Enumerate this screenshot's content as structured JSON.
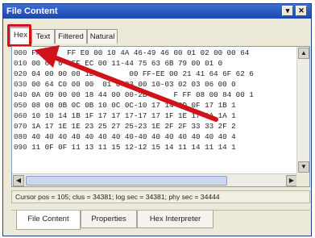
{
  "window": {
    "title": "File Content",
    "pin_glyph": "▾",
    "close_glyph": "✕"
  },
  "tabs": [
    {
      "label": "Hex",
      "active": true
    },
    {
      "label": "Text",
      "active": false
    },
    {
      "label": "Filtered",
      "active": false
    },
    {
      "label": "Natural",
      "active": false
    }
  ],
  "hex_rows": [
    {
      "offset": "000",
      "bytes": "FF  F   FF E0 00 10 4A 46-49 46 00 01 02 00 00 64"
    },
    {
      "offset": "010",
      "bytes": "00 64 0  FF EC 00 11-44 75 63 6B 79 00 01 0"
    },
    {
      "offset": "020",
      "bytes": "04 00 00 00 1E        00 FF-EE 00 21 41 64 6F 62 6"
    },
    {
      "offset": "030",
      "bytes": "00 64 C0 00 00  01 0 03 00 10-03 02 03 06 00 0"
    },
    {
      "offset": "040",
      "bytes": "0A 09 00 00 18 44 00 00-2B      F FF 08 00 84 00 1"
    },
    {
      "offset": "050",
      "bytes": "08 08 0B 0C 0B 10 0C 0C-10 17 14 0D 0F 17 1B 1"
    },
    {
      "offset": "060",
      "bytes": "10 10 14 1B 1F 17 17 17-17 17 1F 1E 17 1A 1A 1"
    },
    {
      "offset": "070",
      "bytes": "1A 17 1E 1E 23 25 27 25-23 1E 2F 2F 33 33 2F 2"
    },
    {
      "offset": "080",
      "bytes": "40 40 40 40 40 40 40 40-40 40 40 40 40 40 40 4"
    },
    {
      "offset": "090",
      "bytes": "11 0F 0F 11 13 11 15 12-12 15 14 11 14 11 14 1"
    }
  ],
  "scroll": {
    "up_glyph": "▲",
    "down_glyph": "▼",
    "left_glyph": "◀",
    "right_glyph": "▶"
  },
  "status": {
    "text": "Cursor pos = 105; clus = 34381; log sec = 34381; phy sec = 34444"
  },
  "bottom_tabs": [
    {
      "label": "File Content",
      "active": true
    },
    {
      "label": "Properties",
      "active": false
    },
    {
      "label": "Hex Interpreter",
      "active": false
    }
  ],
  "annotation": {
    "arrow_color": "#d0121a",
    "highlight_color": "#d0121a"
  }
}
